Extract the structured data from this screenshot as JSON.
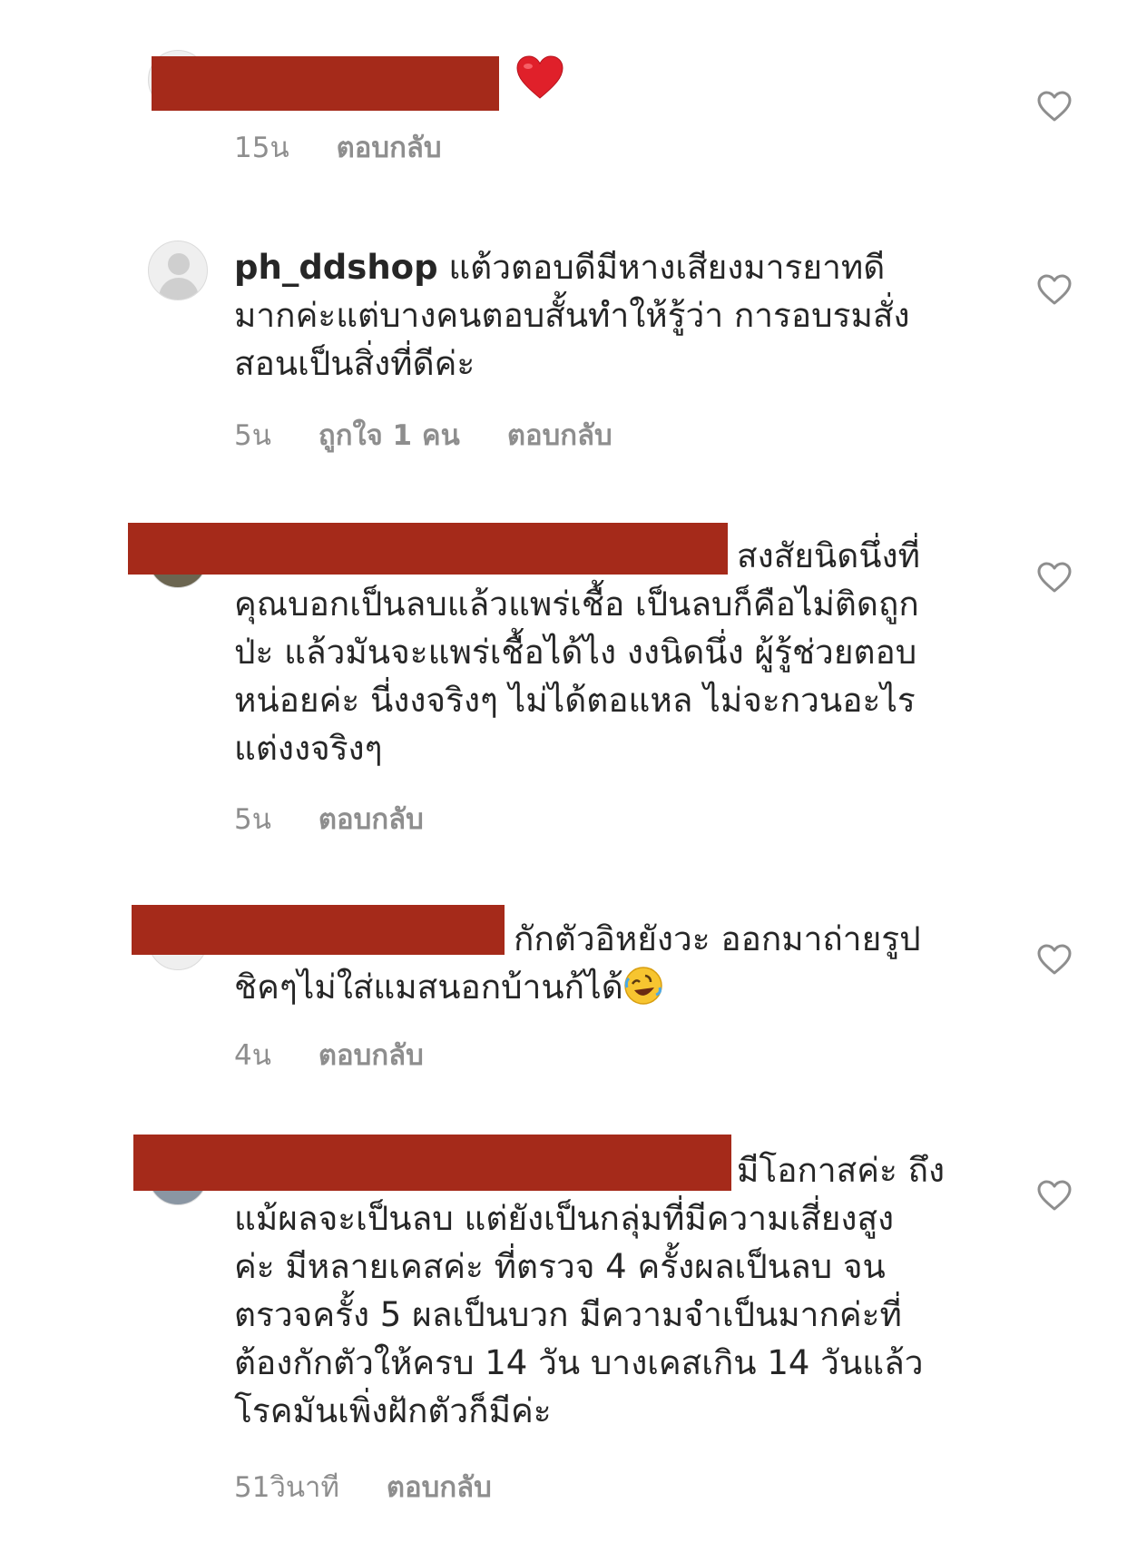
{
  "comments": [
    {
      "username": "",
      "text": "",
      "emoji": "red-heart-emoji",
      "time": "15น",
      "reply": "ตอบกลับ"
    },
    {
      "username": "ph_ddshop",
      "text": " แต้วตอบดีมีหางเสียงมารยาทดี\nมากค่ะแต่บางคนตอบสั้นทำให้รู้ว่า การอบรมสั่ง\nสอนเป็นสิ่งที่ดีค่ะ",
      "time": "5น",
      "likes": "ถูกใจ 1 คน",
      "reply": "ตอบกลับ"
    },
    {
      "username": "",
      "text": "สงสัยนิดนึ่งที่",
      "text_more": "คุณบอกเป็นลบแล้วแพร่เชื้อ เป็นลบก็คือไม่ติดถูก\nป่ะ แล้วมันจะแพร่เชื้อได้ไง งงนิดนึ่ง ผู้รู้ช่วยตอบ\nหน่อยค่ะ นี่งงจริงๆ ไม่ได้ตอแหล ไม่จะกวนอะไร\nแต่งงจริงๆ",
      "time": "5น",
      "reply": "ตอบกลับ"
    },
    {
      "username": "",
      "text": "กักตัวอิหยังวะ ออกมาถ่ายรูป",
      "text_more": "ชิคๆไม่ใส่แมสนอกบ้านก้ได้",
      "emoji": "rolling-laughing-emoji",
      "time": "4น",
      "reply": "ตอบกลับ"
    },
    {
      "username": "",
      "text": "มีโอกาสค่ะ ถึง",
      "text_more": "แม้ผลจะเป็นลบ แต่ยังเป็นกลุ่มที่มีความเสี่ยงสูง\nค่ะ มีหลายเคสค่ะ ที่ตรวจ 4 ครั้งผลเป็นลบ จน\nตรวจครั้ง 5 ผลเป็นบวก มีความจำเป็นมากค่ะที่\nต้องกักตัวให้ครบ 14 วัน บางเคสเกิน 14 วันแล้ว\nโรคมันเพิ่งฝักตัวก็มีค่ะ",
      "time": "51วินาที",
      "reply": "ตอบกลับ"
    }
  ],
  "colors": {
    "redaction": "#a52a1a",
    "meta": "#8e8e8e",
    "text": "#262626"
  }
}
